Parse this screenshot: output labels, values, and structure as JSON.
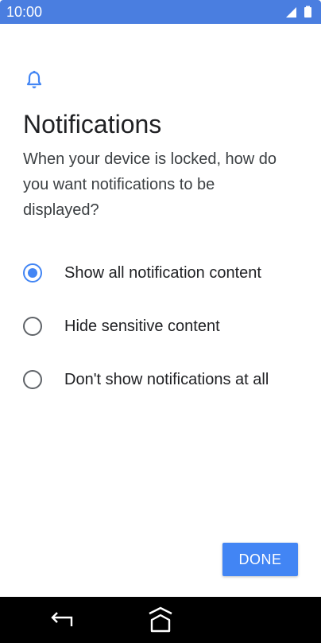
{
  "status_bar": {
    "time": "10:00",
    "icons": [
      "signal-icon",
      "battery-icon"
    ],
    "color": "#4a7ee0"
  },
  "header": {
    "icon": "bell-icon",
    "title": "Notifications",
    "description": "When your device is locked, how do you want notifications to be displayed?"
  },
  "options": [
    {
      "label": "Show all notification content",
      "selected": true
    },
    {
      "label": "Hide sensitive content",
      "selected": false
    },
    {
      "label": "Don't show notifications at all",
      "selected": false
    }
  ],
  "footer": {
    "done_label": "DONE"
  },
  "nav_bar": {
    "icons": [
      "back-icon",
      "home-icon"
    ]
  },
  "colors": {
    "accent": "#4285f4",
    "radio_unchecked": "#5f6368"
  }
}
